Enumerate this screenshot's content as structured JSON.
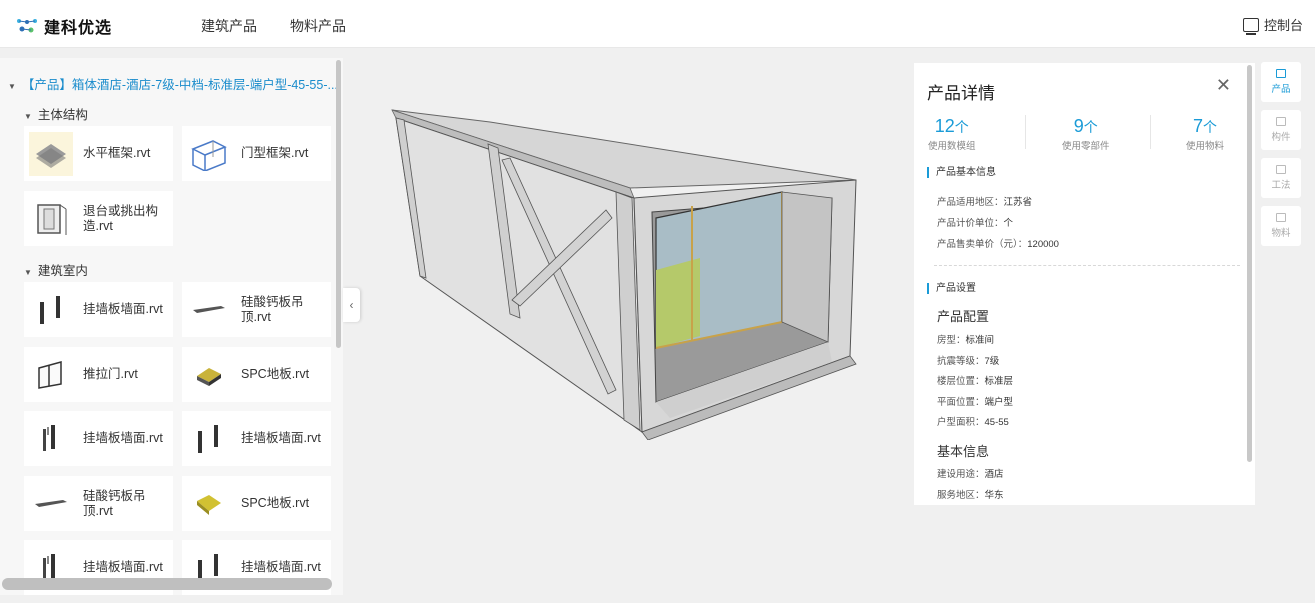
{
  "header": {
    "logo_text": "建科优选",
    "nav": [
      "建筑产品",
      "物料产品"
    ],
    "console_label": "控制台"
  },
  "tree": {
    "root_label": "【产品】箱体酒店-酒店-7级-中档-标准层-端户型-45-55-...",
    "sections": [
      {
        "title": "主体结构",
        "items": [
          {
            "label": "水平框架.rvt",
            "icon": "horizontal-frame-icon"
          },
          {
            "label": "门型框架.rvt",
            "icon": "portal-frame-icon"
          },
          {
            "label": "退台或挑出构造.rvt",
            "icon": "setback-structure-icon"
          }
        ]
      },
      {
        "title": "建筑室内",
        "items": [
          {
            "label": "挂墙板墙面.rvt",
            "icon": "wall-panel-icon"
          },
          {
            "label": "硅酸钙板吊顶.rvt",
            "icon": "ceiling-board-icon"
          },
          {
            "label": "推拉门.rvt",
            "icon": "sliding-door-icon"
          },
          {
            "label": "SPC地板.rvt",
            "icon": "spc-floor-icon"
          },
          {
            "label": "挂墙板墙面.rvt",
            "icon": "wall-panel-icon"
          },
          {
            "label": "挂墙板墙面.rvt",
            "icon": "wall-panel-icon"
          },
          {
            "label": "硅酸钙板吊顶.rvt",
            "icon": "ceiling-board-icon"
          },
          {
            "label": "SPC地板.rvt",
            "icon": "spc-floor-icon"
          },
          {
            "label": "挂墙板墙面.rvt",
            "icon": "wall-panel-icon"
          },
          {
            "label": "挂墙板墙面.rvt",
            "icon": "wall-panel-icon"
          }
        ]
      }
    ]
  },
  "detail": {
    "title": "产品详情",
    "stats": [
      {
        "value": "12",
        "unit": "个",
        "label": "使用数模组"
      },
      {
        "value": "9",
        "unit": "个",
        "label": "使用零部件"
      },
      {
        "value": "7",
        "unit": "个",
        "label": "使用物料"
      }
    ],
    "basic_info": {
      "heading": "产品基本信息",
      "rows": [
        {
          "key": "产品适用地区：",
          "value": "江苏省"
        },
        {
          "key": "产品计价单位：",
          "value": "个"
        },
        {
          "key": "产品售卖单价（元）：",
          "value": "120000"
        }
      ]
    },
    "settings": {
      "heading": "产品设置",
      "config_title": "产品配置",
      "config_rows": [
        {
          "key": "房型：",
          "value": "标准间"
        },
        {
          "key": "抗震等级：",
          "value": "7级"
        },
        {
          "key": "楼层位置：",
          "value": "标准层"
        },
        {
          "key": "平面位置：",
          "value": "端户型"
        },
        {
          "key": "户型面积：",
          "value": "45-55"
        }
      ],
      "basic_title": "基本信息",
      "basic_rows": [
        {
          "key": "建设用途：",
          "value": "酒店"
        },
        {
          "key": "服务地区：",
          "value": "华东"
        }
      ]
    }
  },
  "toolbar": [
    {
      "label": "产品",
      "icon": "product-icon",
      "active": true
    },
    {
      "label": "构件",
      "icon": "component-icon",
      "active": false
    },
    {
      "label": "工法",
      "icon": "method-icon",
      "active": false
    },
    {
      "label": "物料",
      "icon": "material-icon",
      "active": false
    }
  ],
  "colors": {
    "accent": "#1a9bd7",
    "link": "#1a8ccc"
  }
}
